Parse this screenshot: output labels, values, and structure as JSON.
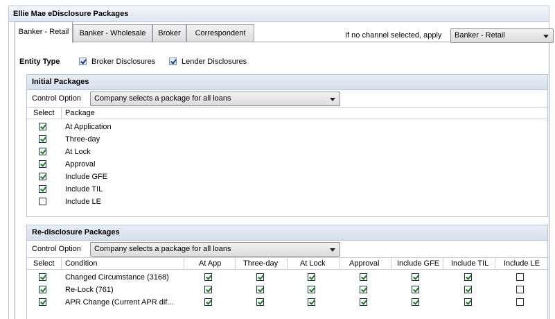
{
  "window": {
    "title": "Ellie Mae eDisclosure Packages"
  },
  "tabs": [
    {
      "label": "Banker - Retail",
      "active": true
    },
    {
      "label": "Banker - Wholesale",
      "active": false
    },
    {
      "label": "Broker",
      "active": false
    },
    {
      "label": "Correspondent",
      "active": false
    }
  ],
  "channel_default": {
    "label": "If no channel selected, apply",
    "value": "Banker - Retail"
  },
  "entity_type": {
    "label": "Entity Type",
    "options": [
      {
        "label": "Broker Disclosures",
        "checked": true
      },
      {
        "label": "Lender Disclosures",
        "checked": true
      }
    ]
  },
  "initial_packages": {
    "title": "Initial Packages",
    "control_option_label": "Control Option",
    "control_option_value": "Company selects a package for all loans",
    "columns": [
      "Select",
      "Package"
    ],
    "rows": [
      {
        "package": "At Application",
        "selected": true
      },
      {
        "package": "Three-day",
        "selected": true
      },
      {
        "package": "At Lock",
        "selected": true
      },
      {
        "package": "Approval",
        "selected": true
      },
      {
        "package": "Include GFE",
        "selected": true
      },
      {
        "package": "Include TIL",
        "selected": true
      },
      {
        "package": "Include LE",
        "selected": false
      }
    ]
  },
  "redisclosure_packages": {
    "title": "Re-disclosure Packages",
    "control_option_label": "Control Option",
    "control_option_value": "Company selects a package for all loans",
    "columns": [
      "Select",
      "Condition",
      "At App",
      "Three-day",
      "At Lock",
      "Approval",
      "Include GFE",
      "Include TIL",
      "Include LE"
    ],
    "rows": [
      {
        "condition": "Changed Circumstance (3168)",
        "checks": [
          true,
          true,
          true,
          true,
          true,
          true,
          true,
          false
        ]
      },
      {
        "condition": "Re-Lock (761)",
        "checks": [
          true,
          true,
          true,
          true,
          true,
          true,
          true,
          false
        ]
      },
      {
        "condition": "APR Change (Current APR dif...",
        "checks": [
          true,
          true,
          true,
          true,
          true,
          true,
          true,
          false
        ]
      }
    ]
  }
}
